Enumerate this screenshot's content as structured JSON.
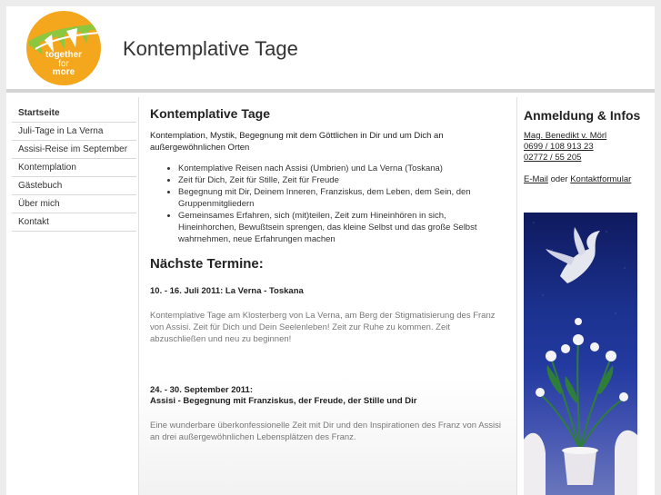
{
  "header": {
    "logo_text": [
      "together",
      "for",
      "more"
    ],
    "site_title": "Kontemplative Tage"
  },
  "nav": {
    "items": [
      {
        "label": "Startseite",
        "active": true
      },
      {
        "label": "Juli-Tage in La Verna"
      },
      {
        "label": "Assisi-Reise im September"
      },
      {
        "label": "Kontemplation"
      },
      {
        "label": "Gästebuch"
      },
      {
        "label": "Über mich"
      },
      {
        "label": "Kontakt"
      }
    ]
  },
  "main": {
    "title": "Kontemplative Tage",
    "intro": "Kontemplation, Mystik, Begegnung mit dem Göttlichen in Dir und um Dich an außergewöhnlichen Orten",
    "bullets": [
      "Kontemplative Reisen nach Assisi (Umbrien) und La Verna (Toskana)",
      "Zeit für Dich, Zeit für Stille, Zeit für Freude",
      "Begegnung mit Dir, Deinem Inneren, Franziskus, dem Leben, dem Sein, den Gruppenmitgliedern",
      "Gemeinsames Erfahren, sich (mit)teilen, Zeit zum Hineinhören in sich, Hineinhorchen, Bewußtsein sprengen, das kleine Selbst und das große Selbst wahrnehmen, neue Erfahrungen machen"
    ],
    "termine_title": "Nächste Termine:",
    "events": [
      {
        "title_lines": [
          "10. - 16. Juli 2011: La Verna - Toskana"
        ],
        "desc": "Kontemplative Tage am Klosterberg von La Verna, am Berg der Stigmatisierung des Franz von Assisi. Zeit für Dich und Dein Seelenleben! Zeit zur Ruhe zu kommen. Zeit abzuschließen und neu zu beginnen!"
      },
      {
        "title_lines": [
          "24. - 30. September 2011:",
          "Assisi - Begegnung mit Franziskus, der Freude, der Stille und Dir"
        ],
        "desc": "Eine wunderbare überkonfessionelle Zeit mit Dir und den Inspirationen des Franz von Assisi an drei außergewöhnlichen Lebensplätzen des Franz."
      }
    ]
  },
  "sidebar_right": {
    "title": "Anmeldung & Infos",
    "contact_name": "Mag. Benedikt v. Mörl",
    "phone1": "0699 / 108 913 23",
    "phone2": "02772 / 55 205",
    "email_label": "E-Mail",
    "or_text": "oder",
    "form_label": "Kontaktformular"
  },
  "colors": {
    "logo_orange": "#f4a71d",
    "logo_green": "#8dc63f",
    "photo_blue": "#233aa0"
  }
}
